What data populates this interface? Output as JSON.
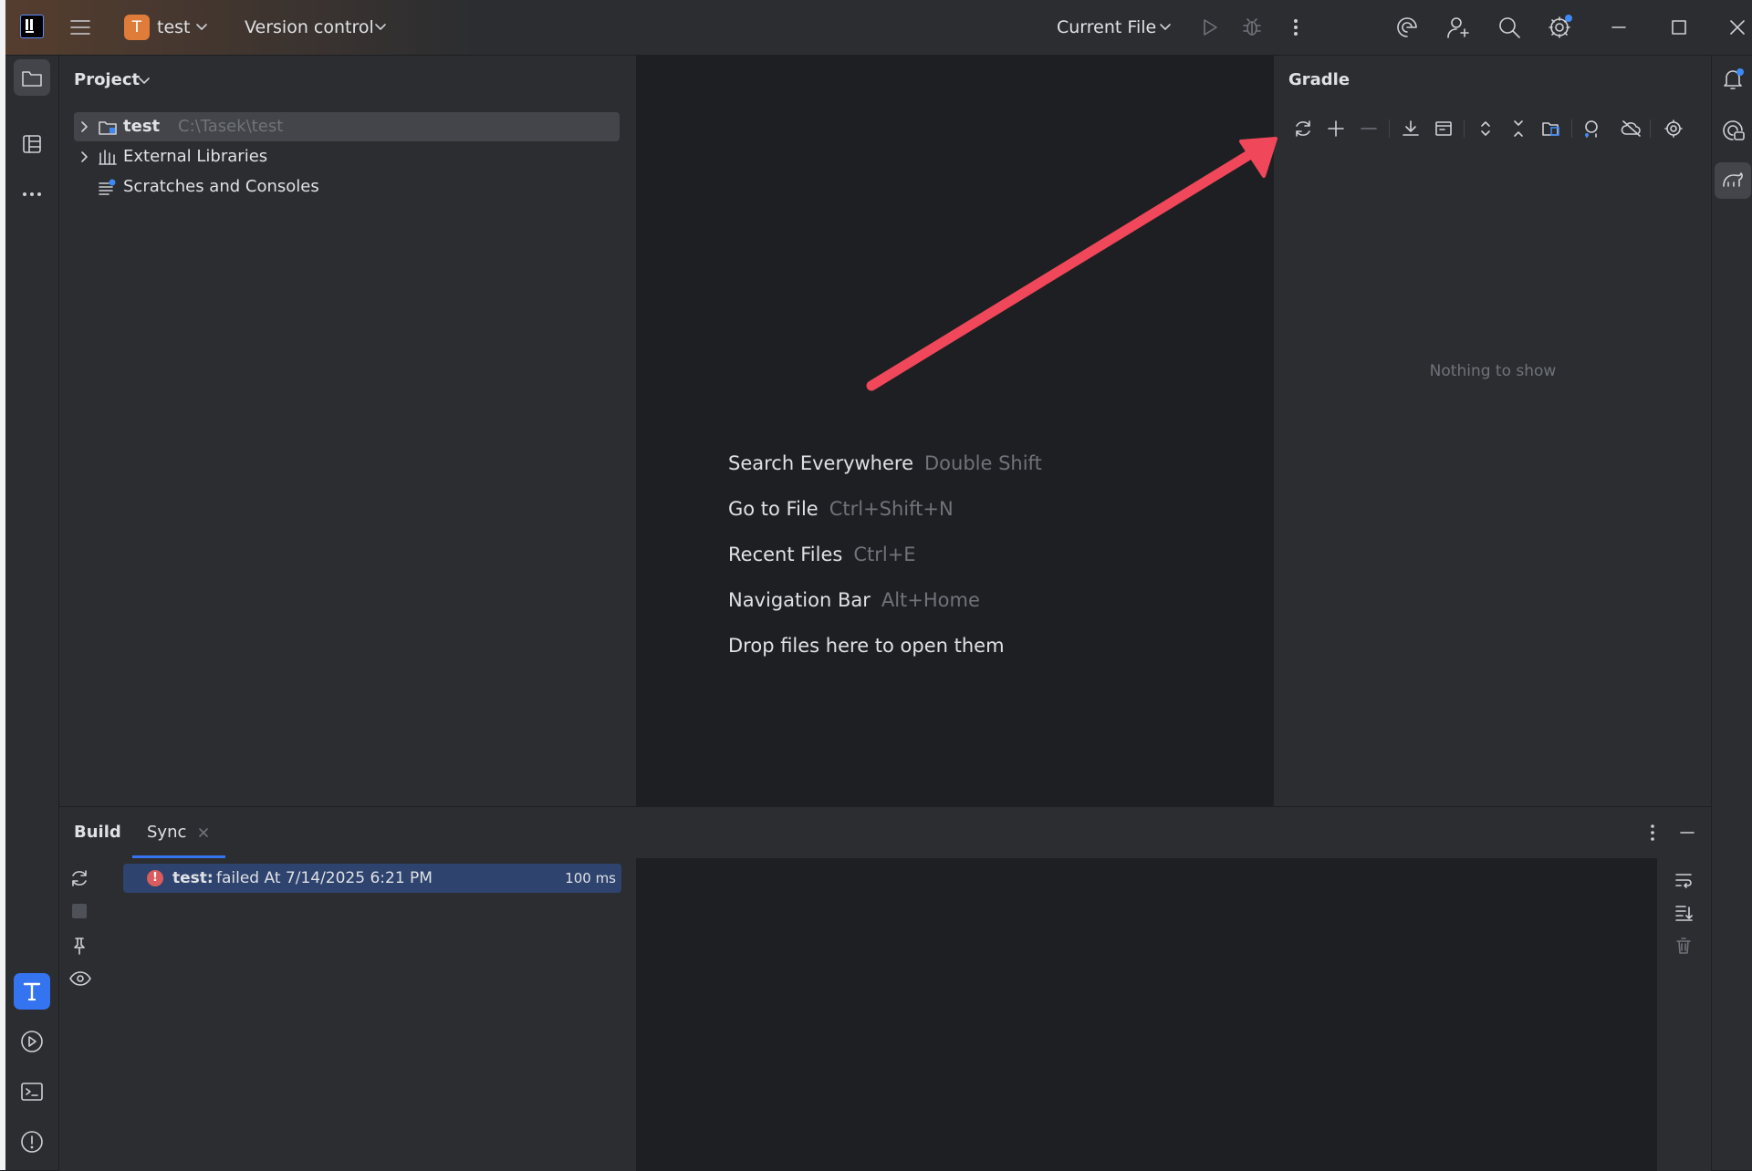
{
  "titlebar": {
    "project_initial": "T",
    "project_name": "test",
    "vcs_label": "Version control",
    "run_config": "Current File",
    "accent_color": "#e07c3a"
  },
  "left_stripe": {
    "items": [
      {
        "icon": "folder-icon"
      },
      {
        "icon": "structure-icon"
      },
      {
        "icon": "more-horizontal-icon"
      }
    ],
    "bottom_items": [
      {
        "icon": "tests-t-icon"
      },
      {
        "icon": "services-play-icon"
      },
      {
        "icon": "terminal-icon"
      },
      {
        "icon": "problems-icon"
      }
    ]
  },
  "project_panel": {
    "title": "Project",
    "tree": [
      {
        "label": "test",
        "path": "C:\\Tasek\\test",
        "expandable": true,
        "selected": true,
        "icon": "module-folder-icon"
      },
      {
        "label": "External Libraries",
        "expandable": true,
        "selected": false,
        "icon": "libraries-icon"
      },
      {
        "label": "Scratches and Consoles",
        "expandable": false,
        "selected": false,
        "icon": "scratches-icon"
      }
    ]
  },
  "editor": {
    "hints": [
      {
        "action": "Search Everywhere",
        "shortcut": "Double Shift"
      },
      {
        "action": "Go to File",
        "shortcut": "Ctrl+Shift+N"
      },
      {
        "action": "Recent Files",
        "shortcut": "Ctrl+E"
      },
      {
        "action": "Navigation Bar",
        "shortcut": "Alt+Home"
      },
      {
        "action": "Drop files here to open them",
        "shortcut": ""
      }
    ]
  },
  "gradle_panel": {
    "title": "Gradle",
    "empty_text": "Nothing to show",
    "toolbar": [
      "reload-icon",
      "add-icon",
      "remove-icon",
      "download-icon",
      "tasks-icon",
      "expand-all-icon",
      "collapse-all-icon",
      "link-project-icon",
      "analyze-dependencies-icon",
      "offline-mode-icon",
      "settings-icon"
    ]
  },
  "annotation": {
    "color": "#f0475a"
  },
  "build_window": {
    "tabs": [
      {
        "label": "Build"
      },
      {
        "label": "Sync"
      }
    ],
    "entry": {
      "title": "test:",
      "status": "failed At 7/14/2025 6:21 PM",
      "duration": "100 ms"
    },
    "error_color": "#db5c5c",
    "selection_color": "#2e436e"
  }
}
